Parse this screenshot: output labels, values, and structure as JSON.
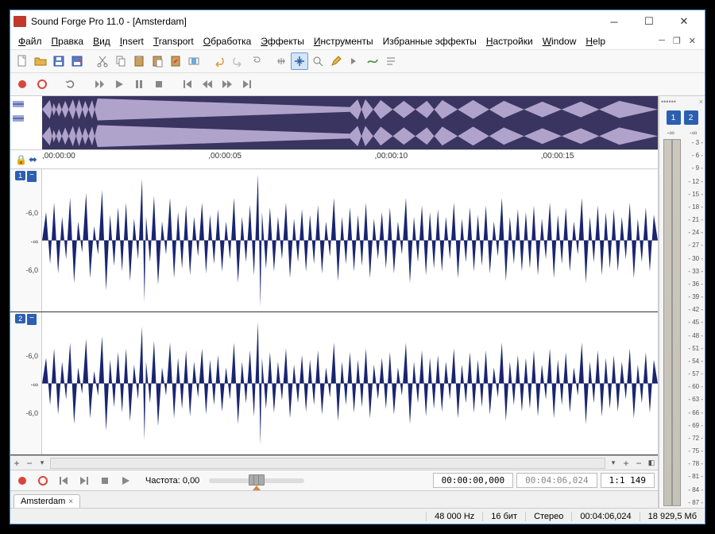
{
  "title": "Sound Forge Pro 11.0 - [Amsterdam]",
  "menu": [
    "Файл",
    "Правка",
    "Вид",
    "Insert",
    "Transport",
    "Обработка",
    "Эффекты",
    "Инструменты",
    "Избранные эффекты",
    "Настройки",
    "Window",
    "Help"
  ],
  "menu_u": [
    "Ф",
    "П",
    "В",
    "I",
    "T",
    "О",
    "Э",
    "И",
    "",
    "Н",
    "W",
    "H"
  ],
  "ruler": {
    "t0": ",00:00:00",
    "t5": ",00:00:05",
    "t10": ",00:00:10",
    "t15": ",00:00:15"
  },
  "channels": {
    "c1": "1",
    "c2": "2"
  },
  "axis": {
    "n6a": "-6,0",
    "inf": "-∞",
    "n6b": "-6,0"
  },
  "transport": {
    "rate_label": "Частота:",
    "rate_value": "0,00",
    "pos": "00:00:00,000",
    "selend": "00:04:06,024",
    "zoom": "1:1 149"
  },
  "tab": {
    "name": "Amsterdam",
    "close": "×"
  },
  "meters": {
    "inf": "-∞"
  },
  "db_ticks": [
    "- 3 -",
    "- 6 -",
    "- 9 -",
    "- 12 -",
    "- 15 -",
    "- 18 -",
    "- 21 -",
    "- 24 -",
    "- 27 -",
    "- 30 -",
    "- 33 -",
    "- 36 -",
    "- 39 -",
    "- 42 -",
    "- 45 -",
    "- 48 -",
    "- 51 -",
    "- 54 -",
    "- 57 -",
    "- 60 -",
    "- 63 -",
    "- 66 -",
    "- 69 -",
    "- 72 -",
    "- 75 -",
    "- 78 -",
    "- 81 -",
    "- 84 -",
    "- 87 -"
  ],
  "status": {
    "sr": "48 000 Hz",
    "bits": "16 бит",
    "mode": "Стерео",
    "dur": "00:04:06,024",
    "mem": "18 929,5 Мб"
  },
  "rp_close": "×",
  "rp_handle": "••••••"
}
